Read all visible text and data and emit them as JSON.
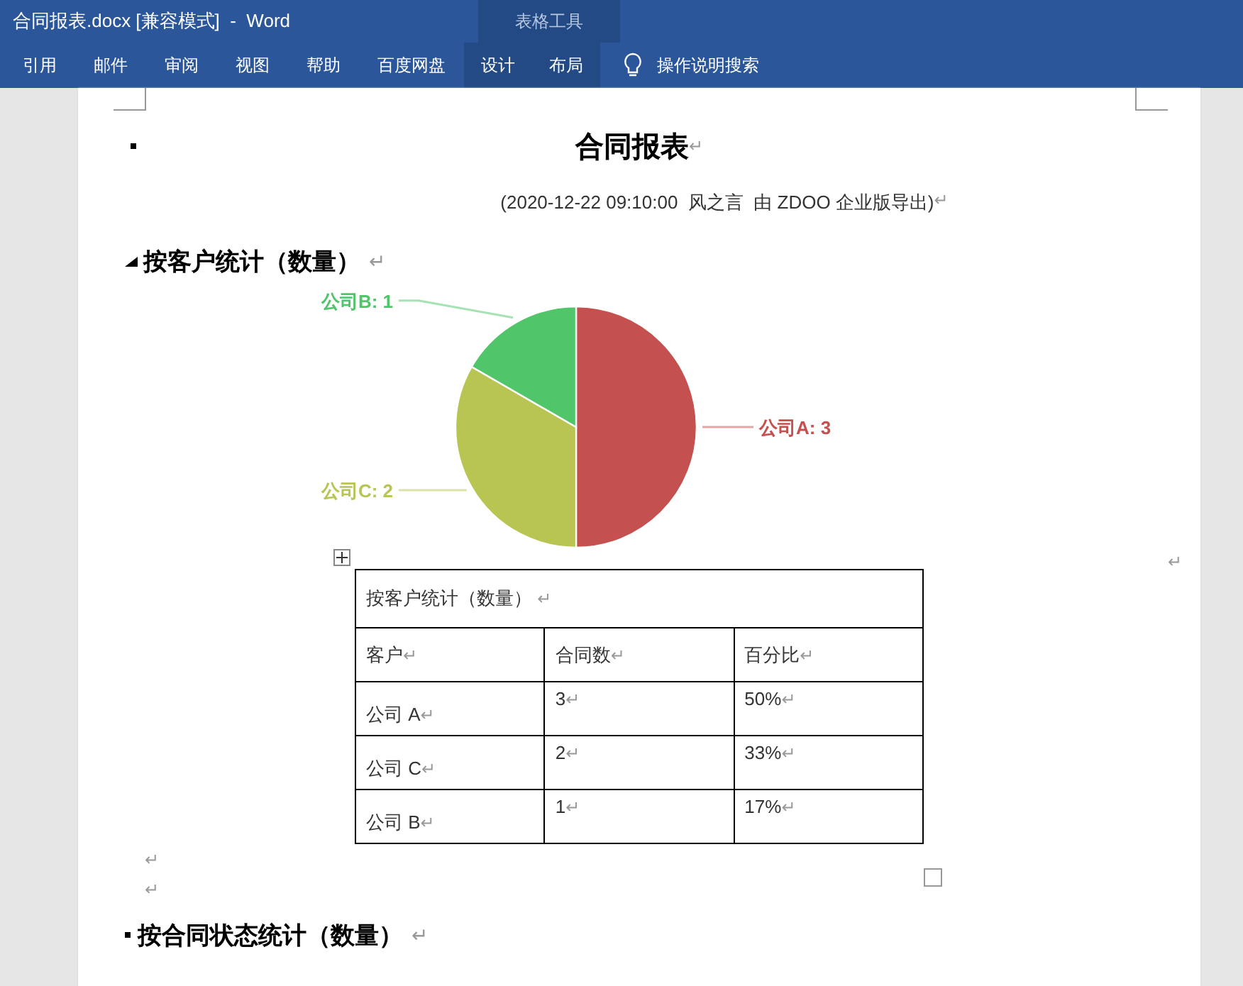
{
  "window": {
    "title": "合同报表.docx [兼容模式]  -  Word"
  },
  "context_group": {
    "label": "表格工具"
  },
  "ribbon_tabs": [
    {
      "label": "引用",
      "selected": false,
      "contextual": false
    },
    {
      "label": "邮件",
      "selected": false,
      "contextual": false
    },
    {
      "label": "审阅",
      "selected": false,
      "contextual": false
    },
    {
      "label": "视图",
      "selected": false,
      "contextual": false
    },
    {
      "label": "帮助",
      "selected": false,
      "contextual": false
    },
    {
      "label": "百度网盘",
      "selected": false,
      "contextual": false
    },
    {
      "label": "设计",
      "selected": false,
      "contextual": true
    },
    {
      "label": "布局",
      "selected": false,
      "contextual": true
    }
  ],
  "tell_me": {
    "label": "操作说明搜索"
  },
  "document": {
    "title": "合同报表",
    "title_mark": "↵",
    "subtitle": "(2020-12-22 09:10:00  风之言  由 ZDOO 企业版导出)",
    "subtitle_mark": "↵",
    "section1": {
      "heading": "按客户统计（数量）",
      "mark": "↵",
      "expanded": true,
      "chart_data": {
        "type": "pie",
        "categories": [
          "公司A: 3",
          "公司C: 2",
          "公司B: 1"
        ],
        "values": [
          3,
          2,
          1
        ],
        "colors": [
          "#c4504f",
          "#b9c553",
          "#50c56a"
        ]
      },
      "chart_mark": "↵",
      "table": {
        "caption": "按客户统计（数量）",
        "caption_mark": "↵",
        "columns": [
          "客户",
          "合同数",
          "百分比"
        ],
        "cell_mark": "↵",
        "rows": [
          [
            "公司 A",
            "3",
            "50%"
          ],
          [
            "公司 C",
            "2",
            "33%"
          ],
          [
            "公司 B",
            "1",
            "17%"
          ]
        ]
      },
      "after_marks": [
        "↵",
        "↵"
      ]
    },
    "section2": {
      "heading": "按合同状态统计（数量）",
      "mark": "↵",
      "expanded": false
    }
  }
}
